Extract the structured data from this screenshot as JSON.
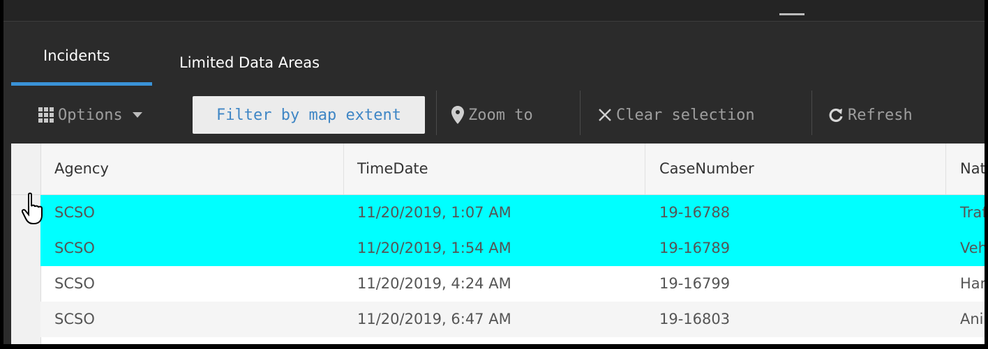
{
  "tabs": [
    {
      "label": "Incidents",
      "active": true
    },
    {
      "label": "Limited Data Areas",
      "active": false
    }
  ],
  "toolbar": {
    "options_label": "Options",
    "filter_label": "Filter by map extent",
    "zoom_label": "Zoom to",
    "clear_label": "Clear selection",
    "refresh_label": "Refresh"
  },
  "table": {
    "columns": [
      "Agency",
      "TimeDate",
      "CaseNumber",
      "Natu"
    ],
    "rows": [
      {
        "agency": "SCSO",
        "timedate": "11/20/2019, 1:07 AM",
        "casenumber": "19-16788",
        "nature": "Traf",
        "selected": true
      },
      {
        "agency": "SCSO",
        "timedate": "11/20/2019, 1:54 AM",
        "casenumber": "19-16789",
        "nature": "Veh",
        "selected": true
      },
      {
        "agency": "SCSO",
        "timedate": "11/20/2019, 4:24 AM",
        "casenumber": "19-16799",
        "nature": "Hara",
        "selected": false
      },
      {
        "agency": "SCSO",
        "timedate": "11/20/2019, 6:47 AM",
        "casenumber": "19-16803",
        "nature": "Anir",
        "selected": false
      }
    ]
  },
  "colors": {
    "accent": "#3a93d8",
    "selection": "#00ffff",
    "toolbar_bg": "#2b2b2b"
  }
}
